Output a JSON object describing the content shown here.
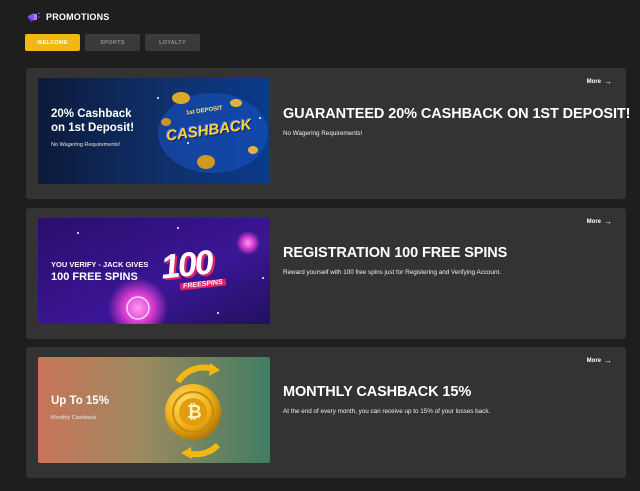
{
  "header": {
    "title": "PROMOTIONS",
    "icon": "megaphone-icon",
    "icon_color": "#8a4fff"
  },
  "tabs": [
    {
      "label": "WELCOME",
      "active": true
    },
    {
      "label": "SPORTS",
      "active": false
    },
    {
      "label": "LOYALTY",
      "active": false
    }
  ],
  "colors": {
    "accent": "#f2b711",
    "card_bg": "#333333",
    "page_bg": "#1e1e1e"
  },
  "promotions": [
    {
      "title": "GUARANTEED 20% CASHBACK ON 1ST DEPOSIT!",
      "description": "No Wagering Requirements!",
      "more_label": "More",
      "banner": {
        "line1": "20% Cashback",
        "line2": "on 1st Deposit!",
        "sub": "No Wagering Requirements!",
        "art_top": "1st DEPOSIT",
        "art_main": "CASHBACK"
      }
    },
    {
      "title": "REGISTRATION 100 FREE SPINS",
      "description": "Reward yourself with 100 free spins just for Registering and Verifying Account.",
      "more_label": "More",
      "banner": {
        "line1": "YOU VERIFY - JACK GIVES",
        "line2": "100 FREE SPINS",
        "art_main": "100",
        "art_sub": "FREESPINS"
      }
    },
    {
      "title": "MONTHLY CASHBACK 15%",
      "description": "At the end of every month, you can receive up to 15% of your losses back.",
      "more_label": "More",
      "banner": {
        "line1": "Up To 15%",
        "sub": "Monthly Cashback"
      }
    }
  ]
}
